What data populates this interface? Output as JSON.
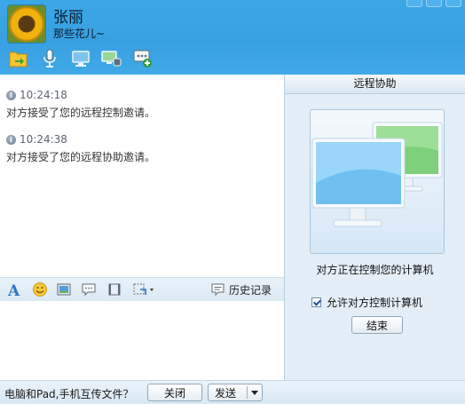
{
  "header": {
    "contact_name": "张丽",
    "signature": "那些花儿~"
  },
  "toolbar": {
    "icons": [
      "send-file-icon",
      "voice-call-icon",
      "remote-desktop-icon",
      "video-call-icon",
      "add-app-icon"
    ]
  },
  "messages": [
    {
      "time": "10:24:18",
      "text": "对方接受了您的远程控制邀请。"
    },
    {
      "time": "10:24:38",
      "text": "对方接受了您的远程协助邀请。"
    }
  ],
  "format_bar": {
    "history_label": "历史记录"
  },
  "bottom": {
    "transfer_link": "电脑和Pad,手机互传文件？",
    "close_label": "关闭",
    "send_label": "发送"
  },
  "panel": {
    "title": "远程协助",
    "status": "对方正在控制您的计算机",
    "allow_control_label": "允许对方控制计算机",
    "allow_control_checked": true,
    "end_label": "结束"
  },
  "colors": {
    "header_blue": "#3ca7e6",
    "panel_bg": "#e3eef7"
  }
}
